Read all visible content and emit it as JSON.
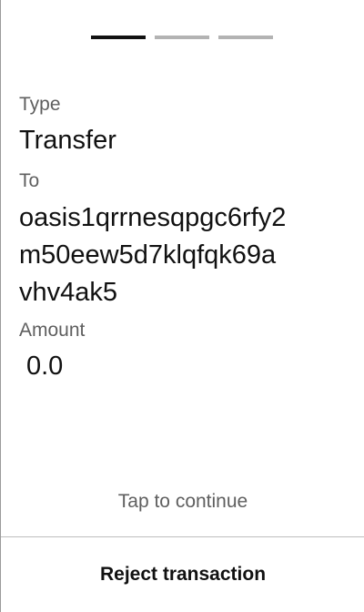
{
  "stepper": {
    "total_steps": 3,
    "current_step": 1
  },
  "fields": {
    "type_label": "Type",
    "type_value": "Transfer",
    "to_label": "To",
    "to_value_lines": [
      "oasis1qrrnesqpgc6rfy2",
      "m50eew5d7klqfqk69a",
      "vhv4ak5"
    ],
    "amount_label": "Amount",
    "amount_value": "0.0"
  },
  "footer": {
    "hint": "Tap to continue",
    "reject_label": "Reject transaction"
  },
  "colors": {
    "text": "#111111",
    "label": "#5f5f5f",
    "step_active": "#111111",
    "step_inactive": "#b3b3b3",
    "divider": "#bdbdbd"
  }
}
